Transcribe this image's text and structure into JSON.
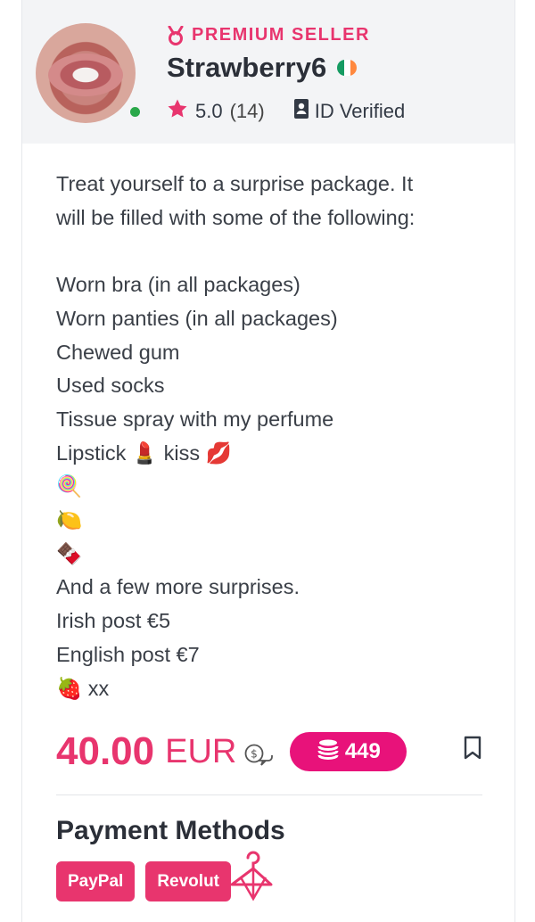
{
  "seller": {
    "badge": "PREMIUM SELLER",
    "name": "Strawberry6",
    "rating": "5.0",
    "review_count": "(14)",
    "verified_label": "ID Verified",
    "flag": "ireland-flag",
    "online": true
  },
  "description": {
    "lines": [
      "Treat yourself to a surprise package. It",
      "will be filled with some of the following:",
      "",
      "Worn bra (in all packages)",
      "Worn panties (in all packages)",
      "Chewed gum",
      "Used socks",
      "Tissue spray with my perfume",
      "Lipstick 💄 kiss 💋",
      "🍭",
      "🍋",
      "🍫",
      "And a few more surprises.",
      "Irish post €5",
      "English post €7",
      "🍓 xx"
    ]
  },
  "price": {
    "amount": "40.00",
    "currency": "EUR",
    "coins": "449"
  },
  "payment": {
    "title": "Payment Methods",
    "methods": [
      "PayPal",
      "Revolut"
    ]
  },
  "colors": {
    "accent": "#e8356e",
    "coins_bg": "#e8127a",
    "header_bg": "#f3f4f6",
    "online": "#2aa84a"
  },
  "icons": {
    "badge": "medal-icon",
    "rating": "star-icon",
    "verified": "id-card-icon",
    "price_chat": "money-chat-icon",
    "coins": "coins-icon",
    "save": "bookmark-icon",
    "hanger": "hanger-icon"
  }
}
